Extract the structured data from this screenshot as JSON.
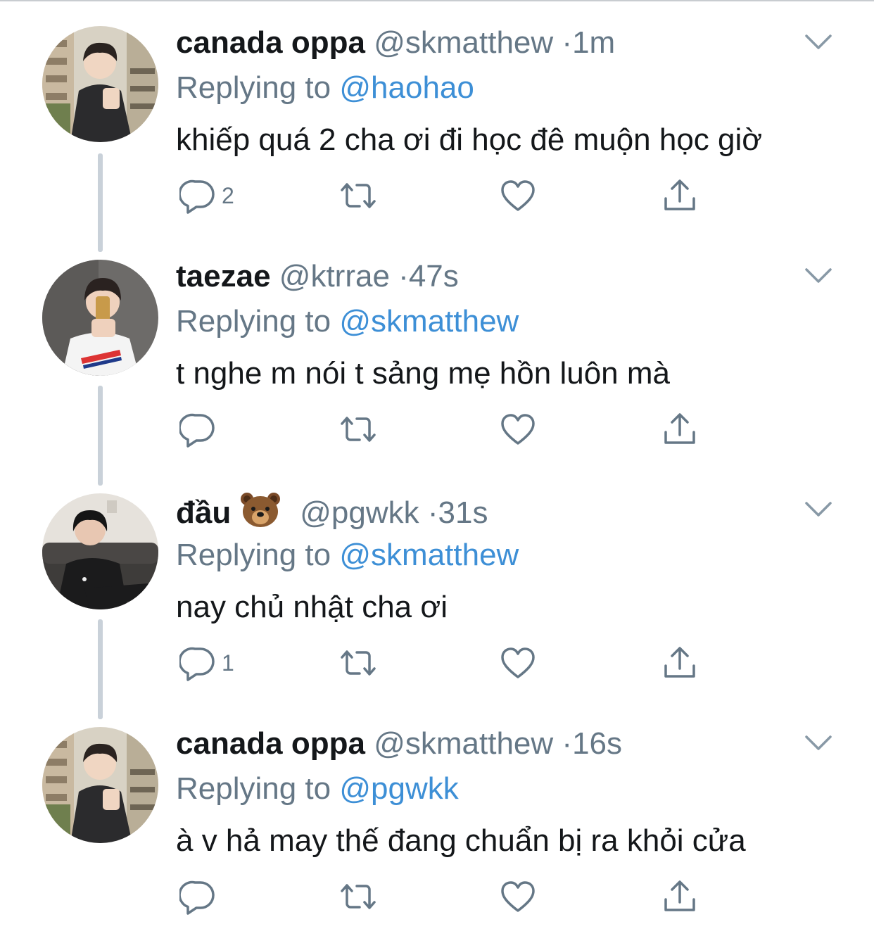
{
  "tweets": [
    {
      "display_name": "canada oppa",
      "emoji": "",
      "handle": "@skmatthew",
      "separator": "·",
      "time": "1m",
      "reply_prefix": "Replying to",
      "reply_to": "@haohao",
      "text": "khiếp quá 2 cha ơi đi học đê muộn học giờ",
      "reply_count": "2"
    },
    {
      "display_name": "taezae",
      "emoji": "",
      "handle": "@ktrrae",
      "separator": "·",
      "time": "47s",
      "reply_prefix": "Replying to",
      "reply_to": "@skmatthew",
      "text": "t nghe m nói t sảng mẹ hồn luôn mà",
      "reply_count": ""
    },
    {
      "display_name": "đầu",
      "emoji": "bear-face-emoji",
      "handle": "@pgwkk",
      "separator": "·",
      "time": "31s",
      "reply_prefix": "Replying to",
      "reply_to": "@skmatthew",
      "text": "nay chủ nhật cha ơi",
      "reply_count": "1"
    },
    {
      "display_name": "canada oppa",
      "emoji": "",
      "handle": "@skmatthew",
      "separator": "·",
      "time": "16s",
      "reply_prefix": "Replying to",
      "reply_to": "@pgwkk",
      "text": "à v hả may thế đang chuẩn bị ra khỏi cửa",
      "reply_count": ""
    }
  ],
  "icons": {
    "reply": "reply-icon",
    "retweet": "retweet-icon",
    "like": "like-icon",
    "share": "share-icon",
    "more": "chevron-down-icon"
  },
  "colors": {
    "text": "#14171a",
    "secondary": "#657786",
    "link": "#3d8fd6",
    "thread_line": "#c9d1d9",
    "background": "#ffffff"
  }
}
